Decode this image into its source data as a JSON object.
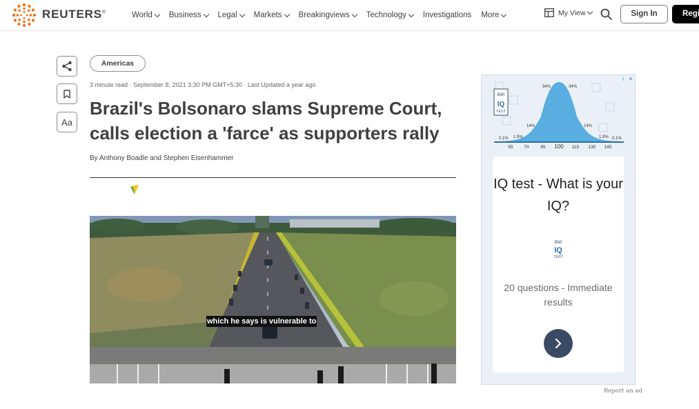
{
  "header": {
    "logo_text": "REUTERS",
    "nav": [
      "World",
      "Business",
      "Legal",
      "Markets",
      "Breakingviews",
      "Technology",
      "Investigations",
      "More"
    ],
    "nav_has_chevron": [
      true,
      true,
      true,
      true,
      true,
      true,
      false,
      true
    ],
    "my_view": "My View",
    "sign_in": "Sign In",
    "register": "Regi"
  },
  "share_tools": {
    "share_icon": "share-icon",
    "bookmark_icon": "bookmark-icon",
    "text_size_label": "Aa"
  },
  "article": {
    "section_tag": "Americas",
    "meta": "3 minute read · September 8, 2021 3:30 PM GMT+5:30 · Last Updated a year ago",
    "headline": "Brazil's Bolsonaro slams Supreme Court, calls election a 'farce' as supporters rally",
    "byline": "By Anthony Boadle and Stephen Eisenhammer",
    "video_caption": "which he says is vulnerable to"
  },
  "ad": {
    "chart_pct_labels": [
      "34%",
      "34%",
      "14%",
      "14%",
      "1.9%",
      "1.9%",
      "0.1%",
      "0.1%"
    ],
    "chart_axis": [
      "55",
      "70",
      "85",
      "100",
      "115",
      "130",
      "145"
    ],
    "badge_lines": [
      "BMI",
      "IQ",
      "TEST"
    ],
    "title": "IQ test - What is your IQ?",
    "text": "20 questions - Immediate results",
    "report": "Report an ad"
  },
  "colors": {
    "accent_orange": "#fa6400",
    "register_bg": "#000000",
    "ad_button": "#3b4a64",
    "bell_curve": "#5aaee0"
  }
}
